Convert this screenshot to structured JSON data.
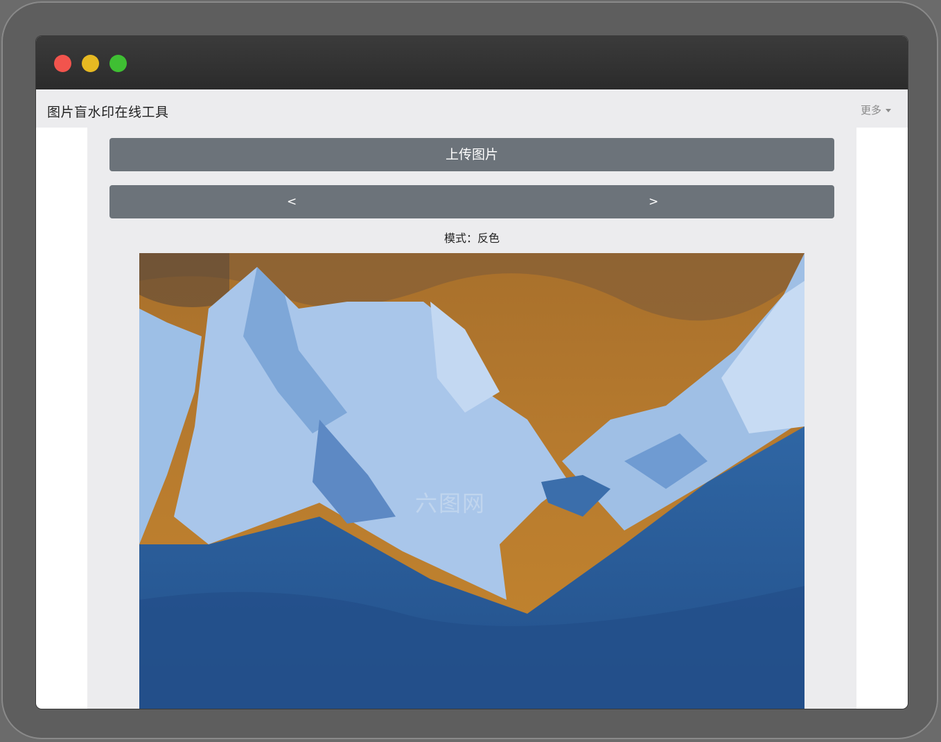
{
  "app": {
    "brand": "图片盲水印在线工具",
    "more_menu": "更多"
  },
  "toolbar": {
    "upload_label": "上传图片",
    "prev_label": "<",
    "next_label": ">"
  },
  "mode": {
    "text": "模式：反色"
  },
  "image": {
    "watermark_text": "六图网",
    "colors": {
      "sky": "#b6782a",
      "ice_light": "#a9c6ea",
      "ice_dark": "#2d5f9a"
    }
  },
  "colors": {
    "button": "#6c737a",
    "panel": "#ececee",
    "titlebar": "#333333"
  }
}
